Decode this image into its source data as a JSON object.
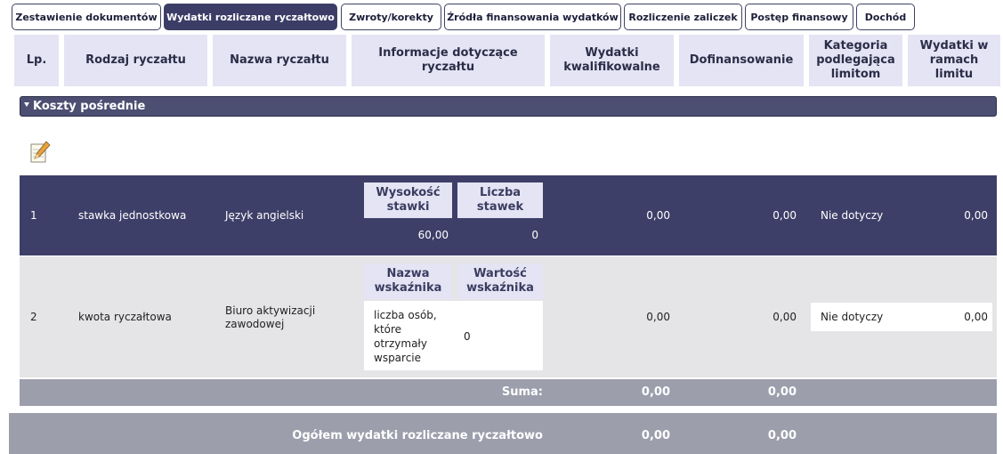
{
  "tabs": [
    {
      "label": "Zestawienie dokumentów",
      "active": false
    },
    {
      "label": "Wydatki rozliczane ryczałtowo",
      "active": true
    },
    {
      "label": "Zwroty/korekty",
      "active": false
    },
    {
      "label": "Źródła finansowania wydatków",
      "active": false
    },
    {
      "label": "Rozliczenie zaliczek",
      "active": false
    },
    {
      "label": "Postęp finansowy",
      "active": false
    },
    {
      "label": "Dochód",
      "active": false
    }
  ],
  "columns": {
    "lp": "Lp.",
    "rodzaj": "Rodzaj ryczałtu",
    "nazwa": "Nazwa ryczałtu",
    "informacje": "Informacje dotyczące ryczałtu",
    "kwalifikowalne": "Wydatki kwalifikowalne",
    "dofinansowanie": "Dofinansowanie",
    "kategoria": "Kategoria podlegająca limitom",
    "limit": "Wydatki w ramach limitu"
  },
  "section": {
    "title": "Koszty pośrednie"
  },
  "edit_icon": "edit-notepad-icon",
  "rows": [
    {
      "lp": "1",
      "rodzaj": "stawka jednostkowa",
      "nazwa": "Język angielski",
      "info_headers": [
        "Wysokość stawki",
        "Liczba stawek"
      ],
      "info_values": [
        "60,00",
        "0"
      ],
      "kwalifikowalne": "0,00",
      "dofinansowanie": "0,00",
      "kategoria": "Nie dotyczy",
      "limit": "0,00"
    },
    {
      "lp": "2",
      "rodzaj": "kwota ryczałtowa",
      "nazwa": "Biuro aktywizacji zawodowej",
      "info_headers": [
        "Nazwa wskaźnika",
        "Wartość wskaźnika"
      ],
      "info_values": [
        "liczba osób, które otrzymały wsparcie",
        "0"
      ],
      "kwalifikowalne": "0,00",
      "dofinansowanie": "0,00",
      "kategoria": "Nie dotyczy",
      "limit": "0,00"
    }
  ],
  "suma": {
    "label": "Suma:",
    "kwalifikowalne": "0,00",
    "dofinansowanie": "0,00"
  },
  "total": {
    "label": "Ogółem wydatki rozliczane ryczałtowo",
    "kwalifikowalne": "0,00",
    "dofinansowanie": "0,00"
  },
  "colors": {
    "accent": "#3b3d67",
    "header_bg": "#e4e4f4",
    "sum_bg": "#9c9eac"
  }
}
